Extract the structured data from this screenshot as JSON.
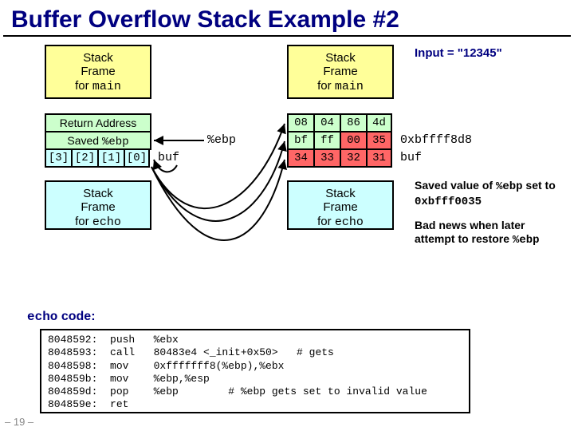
{
  "title": "Buffer Overflow Stack Example #2",
  "page_number": "– 19 –",
  "input_label": "Input = \"12345\"",
  "left": {
    "mainframe_l1": "Stack",
    "mainframe_l2": "Frame",
    "mainframe_l3_a": "for ",
    "mainframe_l3_b": "main",
    "ret_addr": "Return Address",
    "saved_a": "Saved ",
    "saved_b": "%ebp",
    "buf": [
      "[3]",
      "[2]",
      "[1]",
      "[0]"
    ],
    "echoframe_l1": "Stack",
    "echoframe_l2": "Frame",
    "echoframe_l3_a": "for ",
    "echoframe_l3_b": "echo",
    "arrow_ebp": "%ebp",
    "arrow_buf": "buf"
  },
  "right": {
    "mainframe_l1": "Stack",
    "mainframe_l2": "Frame",
    "mainframe_l3_a": "for ",
    "mainframe_l3_b": "main",
    "ret": [
      "08",
      "04",
      "86",
      "4d"
    ],
    "sebp": [
      "bf",
      "ff",
      "00",
      "35"
    ],
    "buf": [
      "34",
      "33",
      "32",
      "31"
    ],
    "echoframe_l1": "Stack",
    "echoframe_l2": "Frame",
    "echoframe_l3_a": "for ",
    "echoframe_l3_b": "echo",
    "lbl_sebp": "0xbffff8d8",
    "lbl_buf": "buf"
  },
  "notes": {
    "n1a": "Saved value of ",
    "n1b": "%ebp",
    "n1c": " set to ",
    "n1d": "0xbfff0035",
    "n2a": "Bad news when later attempt to restore ",
    "n2b": "%ebp"
  },
  "code_caption_a": "echo",
  "code_caption_b": " code:",
  "code": "8048592:  push   %ebx\n8048593:  call   80483e4 <_init+0x50>   # gets\n8048598:  mov    0xfffffff8(%ebp),%ebx\n804859b:  mov    %ebp,%esp\n804859d:  pop    %ebp        # %ebp gets set to invalid value\n804859e:  ret"
}
